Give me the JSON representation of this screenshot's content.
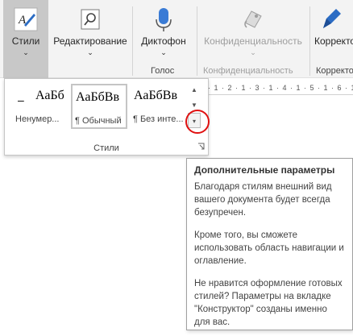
{
  "ribbon": {
    "styles_button": {
      "label": "Стили",
      "chevron": "⌄",
      "icon": "styles-icon"
    },
    "editing_button": {
      "label": "Редактирование",
      "chevron": "⌄",
      "icon": "search-icon"
    },
    "dictate_button": {
      "label": "Диктофон",
      "chevron": "⌄",
      "icon": "microphone-icon"
    },
    "sensitivity_button": {
      "label": "Конфиденциальность",
      "chevron": "⌄",
      "icon": "sensitivity-label-icon",
      "disabled": true
    },
    "editor_button": {
      "label": "Корректор",
      "icon": "editor-pen-icon"
    },
    "groups": {
      "voice": "Голос",
      "sensitivity": "Конфиденциальность",
      "editor": "Корректор"
    }
  },
  "ruler": {
    "marks": "· 1 · 2 · 1 · 3 · 1 · 4 · 1 · 5 · 1 · 6 · 1"
  },
  "styles_gallery": {
    "items": [
      {
        "preview": "АаБб",
        "name": "Ненумер...",
        "selected": false,
        "prefix": "–"
      },
      {
        "preview": "АаБбВв",
        "name": "¶ Обычный",
        "selected": true
      },
      {
        "preview": "АаБбВв",
        "name": "¶ Без инте...",
        "selected": false
      }
    ],
    "group_label": "Стили",
    "scroll_up": "▲",
    "scroll_down": "▼",
    "more": "▾"
  },
  "tooltip": {
    "title": "Дополнительные параметры",
    "paragraphs": [
      "Благодаря стилям внешний вид вашего документа будет всегда безупречен.",
      "Кроме того, вы сможете использовать область навигации и оглавление.",
      "Не нравится оформление готовых стилей? Параметры на вкладке \"Конструктор\" созданы именно для вас."
    ]
  },
  "colors": {
    "highlight_circle": "#e01010",
    "selected_button": "#c8c8c8",
    "editor_icon": "#2b6cc4",
    "mic_icon": "#3a7bd5"
  }
}
